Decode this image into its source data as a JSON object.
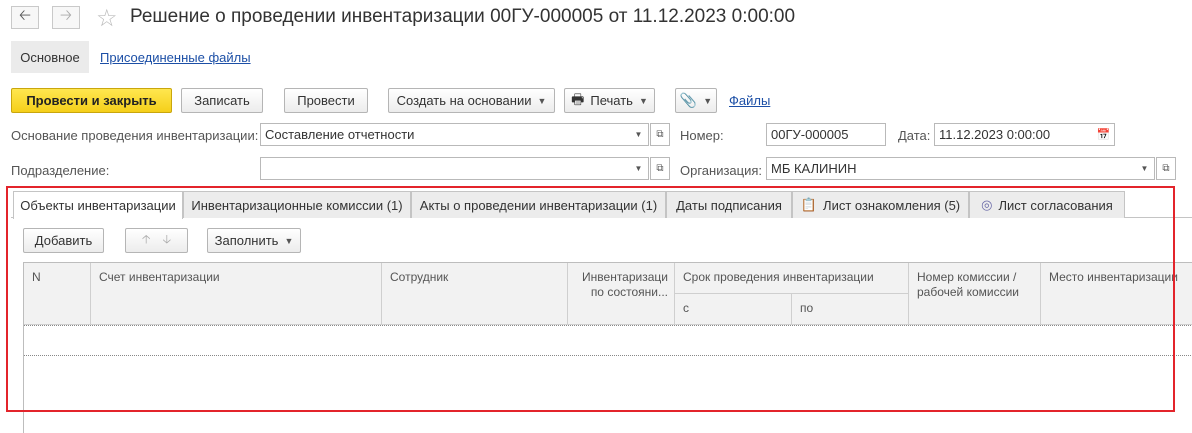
{
  "window": {
    "title": "Решение о проведении инвентаризации 00ГУ-000005 от 11.12.2023 0:00:00",
    "back_icon": "arrow-left-icon",
    "forward_icon": "arrow-right-icon",
    "favorite_icon": "star-icon"
  },
  "sections": {
    "main": "Основное",
    "attached_files": "Присоединенные файлы"
  },
  "toolbar": {
    "post_and_close": "Провести и закрыть",
    "save": "Записать",
    "post": "Провести",
    "create_based_on": "Создать на основании",
    "print": "Печать",
    "files": "Файлы"
  },
  "form": {
    "basis_label": "Основание проведения инвентаризации:",
    "basis_value": "Составление отчетности",
    "number_label": "Номер:",
    "number_value": "00ГУ-000005",
    "date_label": "Дата:",
    "date_value": "11.12.2023  0:00:00",
    "department_label": "Подразделение:",
    "department_value": "",
    "organization_label": "Организация:",
    "organization_value": "МБ КАЛИНИН"
  },
  "tabs": [
    {
      "label": "Объекты инвентаризации"
    },
    {
      "label": "Инвентаризационные комиссии (1)"
    },
    {
      "label": "Акты о проведении инвентаризации (1)"
    },
    {
      "label": "Даты подписания"
    },
    {
      "label": "Лист ознакомления (5)"
    },
    {
      "label": "Лист согласования"
    }
  ],
  "table_toolbar": {
    "add": "Добавить",
    "fill": "Заполнить"
  },
  "table": {
    "columns": {
      "n": "N",
      "account": "Счет инвентаризации",
      "employee": "Сотрудник",
      "as_of": "Инвентаризаци по состояни...",
      "period": "Срок проведения инвентаризации",
      "period_from": "с",
      "period_to": "по",
      "commission": "Номер комиссии / рабочей комиссии",
      "place": "Место инвентаризации"
    },
    "rows": []
  },
  "colors": {
    "accent_button": "#f5cf1a",
    "highlight_frame": "#e3242b",
    "link": "#1c4fa6"
  }
}
